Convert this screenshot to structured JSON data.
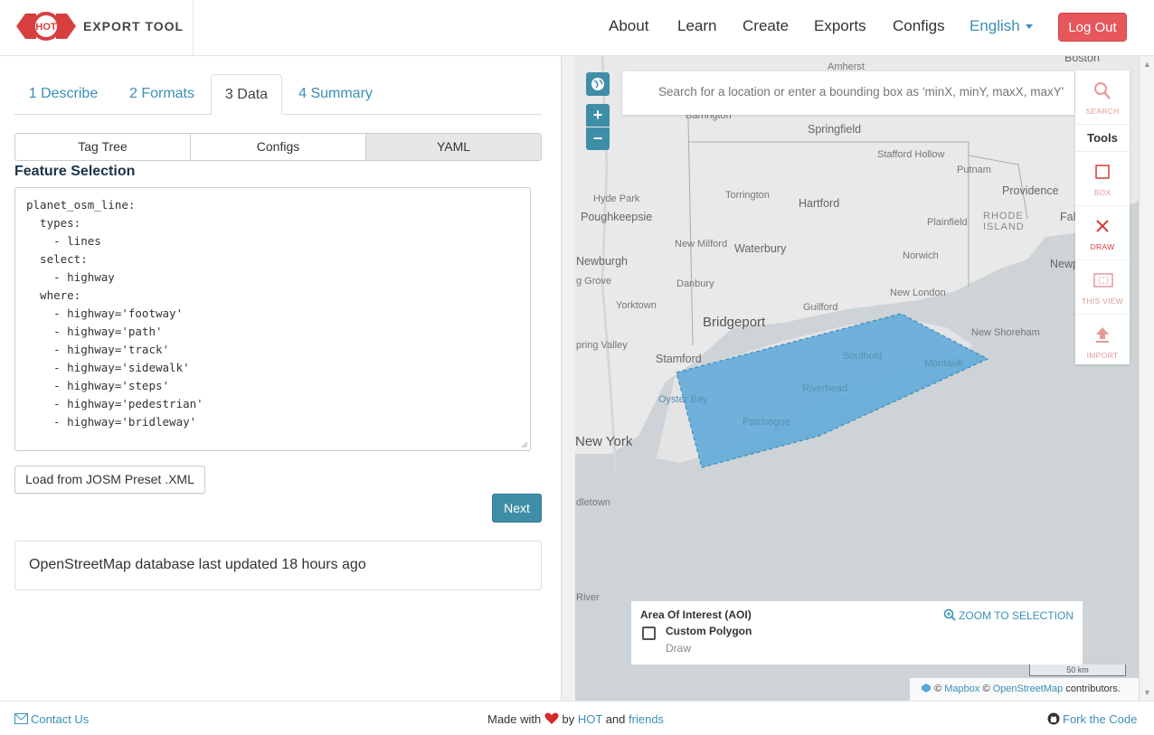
{
  "header": {
    "logo_text": "HOT",
    "brand": "EXPORT TOOL",
    "nav": {
      "about": "About",
      "learn": "Learn",
      "create": "Create",
      "exports": "Exports",
      "configs": "Configs"
    },
    "language": "English",
    "logout": "Log Out",
    "colors": {
      "accent": "#3a8fb7",
      "logout": "#e5575b",
      "logo_red": "#d73f3f"
    }
  },
  "steps": {
    "tabs": [
      "1 Describe",
      "2 Formats",
      "3 Data",
      "4 Summary"
    ],
    "active_tab": "3 Data"
  },
  "data_mode": {
    "buttons": [
      "Tag Tree",
      "Configs",
      "YAML"
    ],
    "active": "YAML"
  },
  "feature_selection": {
    "title": "Feature Selection",
    "yaml": "planet_osm_line:\n  types:\n    - lines\n  select:\n    - highway\n  where:\n    - highway='footway'\n    - highway='path'\n    - highway='track'\n    - highway='sidewalk'\n    - highway='steps'\n    - highway='pedestrian'\n    - highway='bridleway'"
  },
  "actions": {
    "josm": "Load from JOSM Preset .XML",
    "next": "Next"
  },
  "status": {
    "db_updated": "OpenStreetMap database last updated 18 hours ago"
  },
  "map": {
    "search_placeholder": "Search for a location or enter a bounding box as 'minX, minY, maxX, maxY'",
    "zoom_in": "+",
    "zoom_out": "−",
    "tools": {
      "search": "SEARCH",
      "heading": "Tools",
      "box": "BOX",
      "draw": "DRAW",
      "this_view": "THIS VIEW",
      "import": "IMPORT"
    },
    "places": {
      "boston": "Boston",
      "amherst": "Amherst",
      "barrington": "Barrington",
      "springfield": "Springfield",
      "stafford": "Stafford Hollow",
      "putnam": "Putnam",
      "hyde_park": "Hyde Park",
      "poughkeepsie": "Poughkeepsie",
      "torrington": "Torrington",
      "hartford": "Hartford",
      "providence": "Providence",
      "rhode_island": "RHODE\nISLAND",
      "fall_river": "Fall R",
      "plainfield": "Plainfield",
      "new_milford": "New Milford",
      "waterbury": "Waterbury",
      "newburgh": "Newburgh",
      "norwich": "Norwich",
      "newport": "Newport",
      "oak_grove": "g Grove",
      "danbury": "Danbury",
      "new_london": "New London",
      "yorktown": "Yorktown",
      "guilford": "Guilford",
      "bridgeport": "Bridgeport",
      "new_shoreham": "New Shoreham",
      "spring_valley": "pring Valley",
      "stamford": "Stamford",
      "southold": "Southold",
      "montauk": "Montauk",
      "oyster_bay": "Oyster Bay",
      "riverhead": "Riverhead",
      "patchogue": "Patchogue",
      "new_york": "New York",
      "edgetown": "dletown",
      "river": "River"
    },
    "aoi": {
      "title": "Area Of Interest (AOI)",
      "zoom": "ZOOM TO SELECTION",
      "name": "Custom Polygon",
      "type": "Draw"
    },
    "scale": "50 km",
    "attribution": {
      "copy1": "©",
      "mapbox": "Mapbox",
      "copy2": "©",
      "osm": "OpenStreetMap",
      "contrib": "contributors."
    },
    "aoi_color": "#5aa8d8"
  },
  "footer": {
    "contact": "Contact Us",
    "made_with": "Made with",
    "by": "by",
    "hot": "HOT",
    "and": "and",
    "friends": "friends",
    "fork": "Fork the Code"
  }
}
